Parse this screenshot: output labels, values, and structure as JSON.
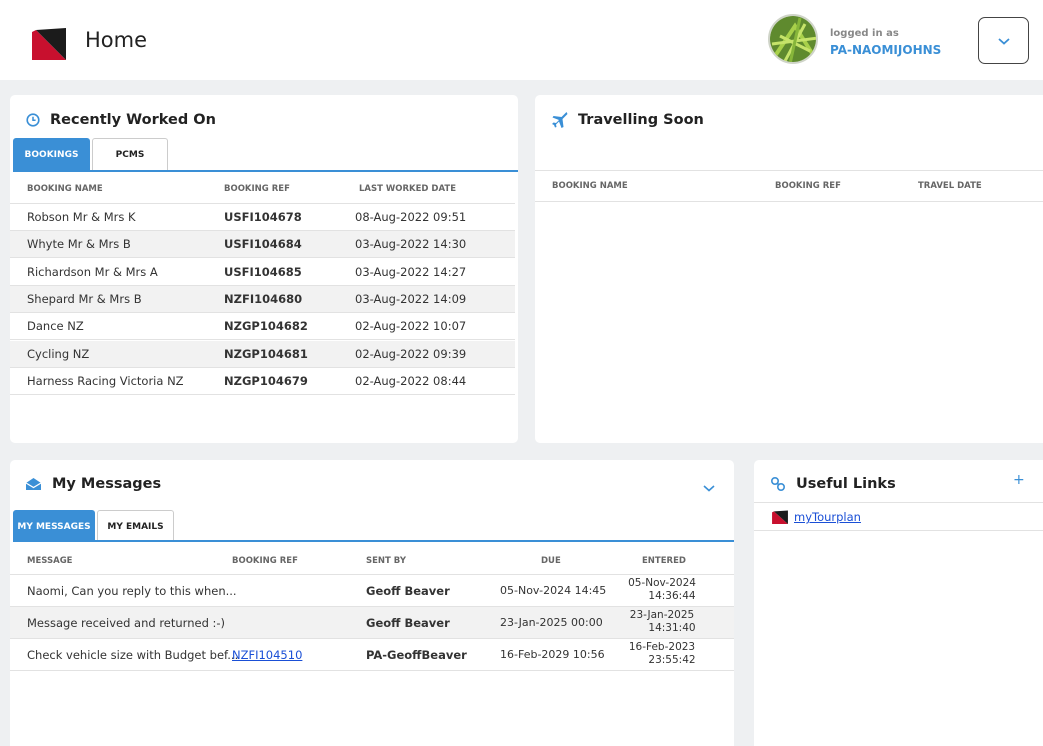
{
  "header": {
    "title": "Home",
    "logged_in_label": "logged in as",
    "username": "PA-NAOMIJOHNS"
  },
  "recent": {
    "title": "Recently Worked On",
    "tabs": [
      "BOOKINGS",
      "PCMS"
    ],
    "columns": [
      "BOOKING NAME",
      "BOOKING REF",
      "LAST WORKED DATE"
    ],
    "rows": [
      {
        "name": "Robson Mr & Mrs K",
        "ref": "USFI104678",
        "date": "08-Aug-2022 09:51"
      },
      {
        "name": "Whyte Mr & Mrs B",
        "ref": "USFI104684",
        "date": "03-Aug-2022 14:30"
      },
      {
        "name": "Richardson Mr & Mrs A",
        "ref": "USFI104685",
        "date": "03-Aug-2022 14:27"
      },
      {
        "name": "Shepard Mr & Mrs B",
        "ref": "NZFI104680",
        "date": "03-Aug-2022 14:09"
      },
      {
        "name": "Dance NZ",
        "ref": "NZGP104682",
        "date": "02-Aug-2022 10:07"
      },
      {
        "name": "Cycling NZ",
        "ref": "NZGP104681",
        "date": "02-Aug-2022 09:39"
      },
      {
        "name": "Harness Racing Victoria NZ",
        "ref": "NZGP104679",
        "date": "02-Aug-2022 08:44"
      }
    ]
  },
  "travelling": {
    "title": "Travelling Soon",
    "columns": [
      "BOOKING NAME",
      "BOOKING REF",
      "TRAVEL DATE"
    ]
  },
  "messages": {
    "title": "My Messages",
    "tabs": [
      "MY MESSAGES",
      "MY EMAILS"
    ],
    "columns": [
      "MESSAGE",
      "BOOKING REF",
      "SENT BY",
      "DUE",
      "ENTERED"
    ],
    "rows": [
      {
        "message": "Naomi, Can you reply to this when...",
        "ref": "",
        "sent_by": "Geoff Beaver",
        "due": "05-Nov-2024 14:45",
        "entered_date": "05-Nov-2024",
        "entered_time": "14:36:44"
      },
      {
        "message": "Message received and returned :-)",
        "ref": "",
        "sent_by": "Geoff Beaver",
        "due": "23-Jan-2025 00:00",
        "entered_date": "23-Jan-2025",
        "entered_time": "14:31:40"
      },
      {
        "message": "Check vehicle size with Budget bef...",
        "ref": "NZFI104510",
        "sent_by": "PA-GeoffBeaver",
        "due": "16-Feb-2029 10:56",
        "entered_date": "16-Feb-2023",
        "entered_time": "23:55:42"
      }
    ]
  },
  "links": {
    "title": "Useful Links",
    "add_label": "+",
    "items": [
      "myTourplan"
    ]
  },
  "colors": {
    "accent": "#3a8fd6",
    "brand_red": "#c8102e"
  }
}
